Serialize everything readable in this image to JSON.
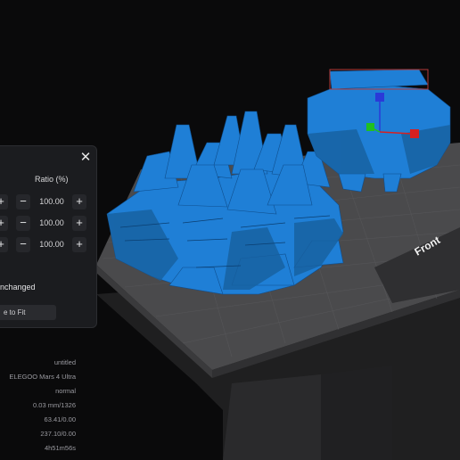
{
  "scale_panel": {
    "ratio_header": "Ratio (%)",
    "rows": [
      {
        "value": "100.00"
      },
      {
        "value": "100.00"
      },
      {
        "value": "100.00"
      }
    ],
    "unchanged_label": "nchanged",
    "fit_button_label": "e to Fit",
    "close_icon": "close-icon"
  },
  "info": {
    "file_name": "untitled",
    "printer": "ELEGOO Mars 4 Ultra",
    "mode": "normal",
    "layer_info": "0.03 mm/1326",
    "volume": "63.41/0.00",
    "cost": "237.10/0.00",
    "print_time": "4h51m56s"
  },
  "viewport": {
    "plate_label": "Front",
    "model_color": "#1f7fd6",
    "plate_color": "#4a4a4c"
  }
}
